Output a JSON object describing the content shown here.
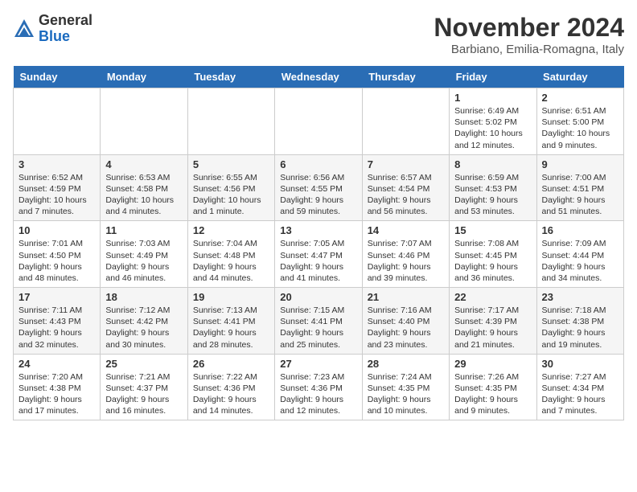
{
  "logo": {
    "general": "General",
    "blue": "Blue"
  },
  "header": {
    "month": "November 2024",
    "location": "Barbiano, Emilia-Romagna, Italy"
  },
  "weekdays": [
    "Sunday",
    "Monday",
    "Tuesday",
    "Wednesday",
    "Thursday",
    "Friday",
    "Saturday"
  ],
  "weeks": [
    [
      {
        "day": "",
        "info": ""
      },
      {
        "day": "",
        "info": ""
      },
      {
        "day": "",
        "info": ""
      },
      {
        "day": "",
        "info": ""
      },
      {
        "day": "",
        "info": ""
      },
      {
        "day": "1",
        "info": "Sunrise: 6:49 AM\nSunset: 5:02 PM\nDaylight: 10 hours and 12 minutes."
      },
      {
        "day": "2",
        "info": "Sunrise: 6:51 AM\nSunset: 5:00 PM\nDaylight: 10 hours and 9 minutes."
      }
    ],
    [
      {
        "day": "3",
        "info": "Sunrise: 6:52 AM\nSunset: 4:59 PM\nDaylight: 10 hours and 7 minutes."
      },
      {
        "day": "4",
        "info": "Sunrise: 6:53 AM\nSunset: 4:58 PM\nDaylight: 10 hours and 4 minutes."
      },
      {
        "day": "5",
        "info": "Sunrise: 6:55 AM\nSunset: 4:56 PM\nDaylight: 10 hours and 1 minute."
      },
      {
        "day": "6",
        "info": "Sunrise: 6:56 AM\nSunset: 4:55 PM\nDaylight: 9 hours and 59 minutes."
      },
      {
        "day": "7",
        "info": "Sunrise: 6:57 AM\nSunset: 4:54 PM\nDaylight: 9 hours and 56 minutes."
      },
      {
        "day": "8",
        "info": "Sunrise: 6:59 AM\nSunset: 4:53 PM\nDaylight: 9 hours and 53 minutes."
      },
      {
        "day": "9",
        "info": "Sunrise: 7:00 AM\nSunset: 4:51 PM\nDaylight: 9 hours and 51 minutes."
      }
    ],
    [
      {
        "day": "10",
        "info": "Sunrise: 7:01 AM\nSunset: 4:50 PM\nDaylight: 9 hours and 48 minutes."
      },
      {
        "day": "11",
        "info": "Sunrise: 7:03 AM\nSunset: 4:49 PM\nDaylight: 9 hours and 46 minutes."
      },
      {
        "day": "12",
        "info": "Sunrise: 7:04 AM\nSunset: 4:48 PM\nDaylight: 9 hours and 44 minutes."
      },
      {
        "day": "13",
        "info": "Sunrise: 7:05 AM\nSunset: 4:47 PM\nDaylight: 9 hours and 41 minutes."
      },
      {
        "day": "14",
        "info": "Sunrise: 7:07 AM\nSunset: 4:46 PM\nDaylight: 9 hours and 39 minutes."
      },
      {
        "day": "15",
        "info": "Sunrise: 7:08 AM\nSunset: 4:45 PM\nDaylight: 9 hours and 36 minutes."
      },
      {
        "day": "16",
        "info": "Sunrise: 7:09 AM\nSunset: 4:44 PM\nDaylight: 9 hours and 34 minutes."
      }
    ],
    [
      {
        "day": "17",
        "info": "Sunrise: 7:11 AM\nSunset: 4:43 PM\nDaylight: 9 hours and 32 minutes."
      },
      {
        "day": "18",
        "info": "Sunrise: 7:12 AM\nSunset: 4:42 PM\nDaylight: 9 hours and 30 minutes."
      },
      {
        "day": "19",
        "info": "Sunrise: 7:13 AM\nSunset: 4:41 PM\nDaylight: 9 hours and 28 minutes."
      },
      {
        "day": "20",
        "info": "Sunrise: 7:15 AM\nSunset: 4:41 PM\nDaylight: 9 hours and 25 minutes."
      },
      {
        "day": "21",
        "info": "Sunrise: 7:16 AM\nSunset: 4:40 PM\nDaylight: 9 hours and 23 minutes."
      },
      {
        "day": "22",
        "info": "Sunrise: 7:17 AM\nSunset: 4:39 PM\nDaylight: 9 hours and 21 minutes."
      },
      {
        "day": "23",
        "info": "Sunrise: 7:18 AM\nSunset: 4:38 PM\nDaylight: 9 hours and 19 minutes."
      }
    ],
    [
      {
        "day": "24",
        "info": "Sunrise: 7:20 AM\nSunset: 4:38 PM\nDaylight: 9 hours and 17 minutes."
      },
      {
        "day": "25",
        "info": "Sunrise: 7:21 AM\nSunset: 4:37 PM\nDaylight: 9 hours and 16 minutes."
      },
      {
        "day": "26",
        "info": "Sunrise: 7:22 AM\nSunset: 4:36 PM\nDaylight: 9 hours and 14 minutes."
      },
      {
        "day": "27",
        "info": "Sunrise: 7:23 AM\nSunset: 4:36 PM\nDaylight: 9 hours and 12 minutes."
      },
      {
        "day": "28",
        "info": "Sunrise: 7:24 AM\nSunset: 4:35 PM\nDaylight: 9 hours and 10 minutes."
      },
      {
        "day": "29",
        "info": "Sunrise: 7:26 AM\nSunset: 4:35 PM\nDaylight: 9 hours and 9 minutes."
      },
      {
        "day": "30",
        "info": "Sunrise: 7:27 AM\nSunset: 4:34 PM\nDaylight: 9 hours and 7 minutes."
      }
    ]
  ]
}
